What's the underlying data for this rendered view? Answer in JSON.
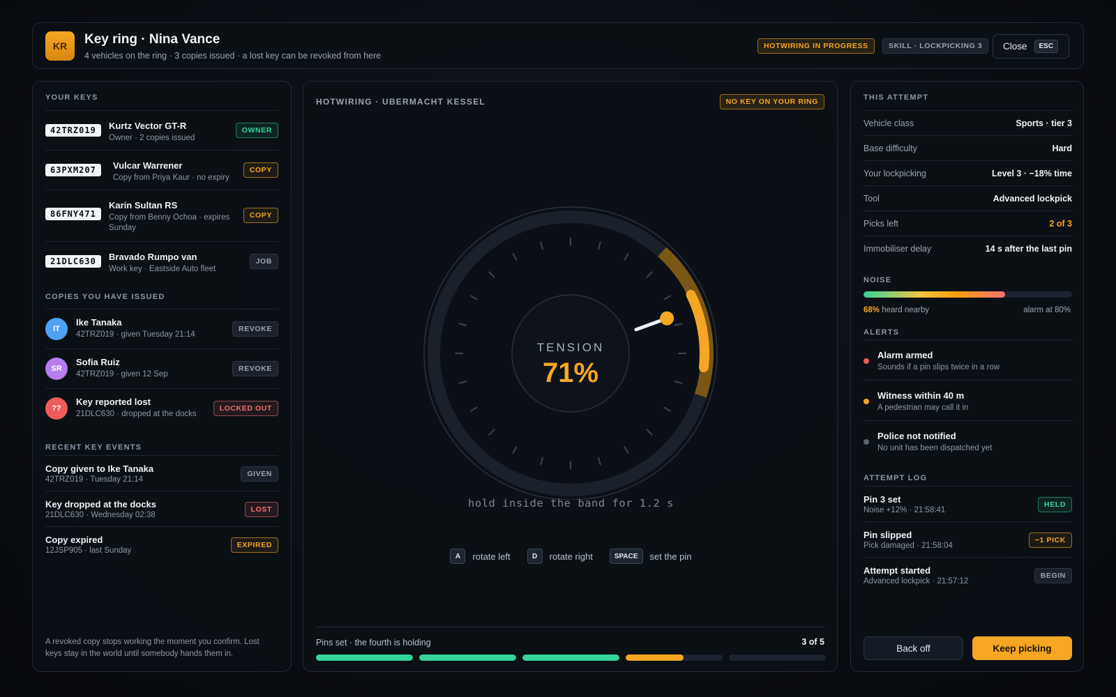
{
  "header": {
    "initials": "KR",
    "title": "Key ring · Nina Vance",
    "subtitle": "4 vehicles on the ring · 3 copies issued · a lost key can be revoked from here",
    "status_badge": "HOTWIRING IN PROGRESS",
    "skill_badge": "SKILL · LOCKPICKING 3",
    "close_label": "Close",
    "close_key": "ESC"
  },
  "left": {
    "keys_label": "YOUR KEYS",
    "keys": [
      {
        "plate": "42TRZ019",
        "name": "Kurtz Vector GT-R",
        "detail": "Owner · 2 copies issued",
        "badge": "OWNER"
      },
      {
        "plate": "63PXM207",
        "name": "Vulcar Warrener",
        "detail": "Copy from Priya Kaur · no expiry",
        "badge": "COPY"
      },
      {
        "plate": "86FNY471",
        "name": "Karin Sultan RS",
        "detail": "Copy from Benny Ochoa · expires Sunday",
        "badge": "COPY"
      },
      {
        "plate": "21DLC630",
        "name": "Bravado Rumpo van",
        "detail": "Work key · Eastside Auto fleet",
        "badge": "JOB"
      }
    ],
    "copies_label": "COPIES YOU HAVE ISSUED",
    "copies": [
      {
        "initials": "IT",
        "name": "Ike Tanaka",
        "detail": "42TRZ019 · given Tuesday 21:14",
        "action": "REVOKE",
        "color": "#4ea3f5"
      },
      {
        "initials": "SR",
        "name": "Sofia Ruiz",
        "detail": "42TRZ019 · given 12 Sep",
        "action": "REVOKE",
        "color": "#b77cf0"
      },
      {
        "initials": "??",
        "name": "Key reported lost",
        "detail": "21DLC630 · dropped at the docks",
        "action": "LOCKED OUT",
        "color": "#f05a5a"
      }
    ],
    "events_label": "RECENT KEY EVENTS",
    "events": [
      {
        "title": "Copy given to Ike Tanaka",
        "detail": "42TRZ019 · Tuesday 21:14",
        "badge": "GIVEN"
      },
      {
        "title": "Key dropped at the docks",
        "detail": "21DLC630 · Wednesday 02:38",
        "badge": "LOST"
      },
      {
        "title": "Copy expired",
        "detail": "12JSP905 · last Sunday",
        "badge": "EXPIRED"
      }
    ],
    "footnote": "A revoked copy stops working the moment you confirm. Lost keys stay in the world until somebody hands them in."
  },
  "center": {
    "title": "HOTWIRING · UBERMACHT KESSEL",
    "warning_badge": "NO KEY ON YOUR RING",
    "tension_label": "TENSION",
    "tension_value": "71%",
    "tension_percent": 71,
    "hint": "hold inside the band for 1.2 s",
    "controls": [
      {
        "key": "A",
        "label": "rotate left"
      },
      {
        "key": "D",
        "label": "rotate right"
      },
      {
        "key": "SPACE",
        "label": "set the pin"
      }
    ],
    "pins_label": "Pins set · the fourth is holding",
    "pins_count": "3 of 5",
    "pins": [
      {
        "fill": 1.0,
        "color": "#34d399"
      },
      {
        "fill": 1.0,
        "color": "#34d399"
      },
      {
        "fill": 1.0,
        "color": "#34d399"
      },
      {
        "fill": 0.6,
        "color": "#f5a623"
      },
      {
        "fill": 0.0,
        "color": "#f5a623"
      }
    ]
  },
  "right": {
    "attempt_label": "THIS ATTEMPT",
    "attempt": [
      {
        "k": "Vehicle class",
        "v": "Sports · tier 3"
      },
      {
        "k": "Base difficulty",
        "v": "Hard"
      },
      {
        "k": "Your lockpicking",
        "v": "Level 3 · −18% time"
      },
      {
        "k": "Tool",
        "v": "Advanced lockpick"
      },
      {
        "k": "Picks left",
        "v": "2 of 3"
      },
      {
        "k": "Immobiliser delay",
        "v": "14 s after the last pin"
      }
    ],
    "noise_label": "NOISE",
    "noise_percent": 68,
    "noise_value": "68%",
    "noise_text": "heard nearby",
    "noise_threshold": "alarm at 80%",
    "alerts_label": "ALERTS",
    "alerts": [
      {
        "title": "Alarm armed",
        "detail": "Sounds if a pin slips twice in a row",
        "color": "#f05a5a"
      },
      {
        "title": "Witness within 40 m",
        "detail": "A pedestrian may call it in",
        "color": "#f5a623"
      },
      {
        "title": "Police not notified",
        "detail": "No unit has been dispatched yet",
        "color": "#5b6472"
      }
    ],
    "log_label": "ATTEMPT LOG",
    "log": [
      {
        "title": "Pin 3 set",
        "detail": "Noise +12% · 21:58:41",
        "badge": "HELD"
      },
      {
        "title": "Pin slipped",
        "detail": "Pick damaged · 21:58:04",
        "badge": "−1 PICK"
      },
      {
        "title": "Attempt started",
        "detail": "Advanced lockpick · 21:57:12",
        "badge": "BEGIN"
      }
    ],
    "back_label": "Back off",
    "keep_label": "Keep picking"
  },
  "colors": {
    "accent": "#f5a623",
    "success": "#34d399",
    "danger": "#f87171"
  }
}
